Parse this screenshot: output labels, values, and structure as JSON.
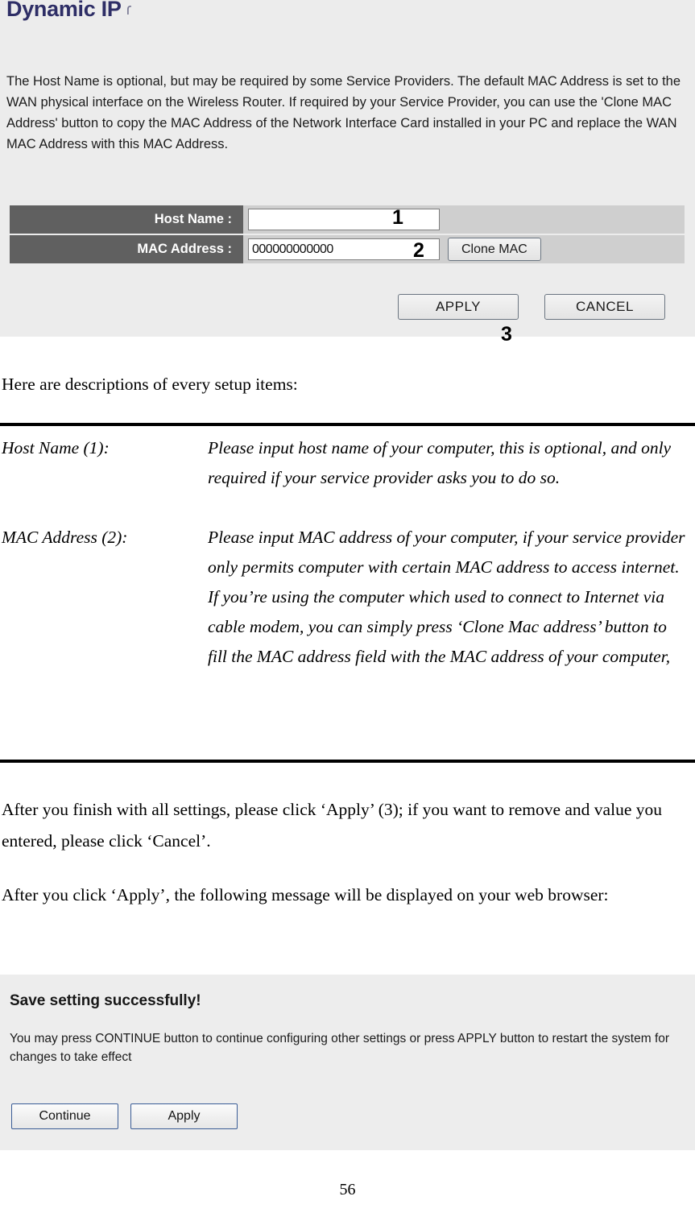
{
  "router_screenshot": {
    "title": "Dynamic IP",
    "title_glyph": "icon-glyph",
    "description": "The Host Name is optional, but may be required by some Service Providers. The default MAC Address is set to the WAN physical interface on the Wireless Router. If required by your Service Provider, you can use the 'Clone MAC Address' button to copy the MAC Address of the Network Interface Card installed in your PC and replace the WAN MAC Address with this MAC Address.",
    "fields": [
      {
        "label": "Host Name :",
        "value": "",
        "callout": "1"
      },
      {
        "label": "MAC Address :",
        "value": "000000000000",
        "callout": "2"
      }
    ],
    "clone_button": "Clone MAC",
    "apply_button": "APPLY",
    "cancel_button": "CANCEL",
    "apply_callout": "3",
    "colors": {
      "panel_background": "#ececec",
      "label_cell": "#606060",
      "field_cell": "#cfcfcf",
      "title_text": "#2e2e66"
    }
  },
  "document": {
    "intro": "Here are descriptions of every setup items:",
    "descriptions": [
      {
        "term": "Host Name (1):",
        "text": "Please input host name of your computer, this is optional, and only required if your service provider asks you to do so."
      },
      {
        "term": "MAC Address (2):",
        "text": "Please input MAC address of your computer, if your service provider only permits computer with certain MAC address to access internet. If you’re using the computer which used to connect to Internet via cable modem, you can simply press ‘Clone Mac address’ button to fill the MAC address field with the MAC address of your computer,"
      }
    ],
    "paragraphs": [
      "After you finish with all settings, please click ‘Apply’ (3); if you want to remove and value you entered, please click ‘Cancel’.",
      "After you click ‘Apply’, the following message will be displayed on your web browser:"
    ],
    "page_number": "56"
  },
  "save_dialog": {
    "title": "Save setting successfully!",
    "message": "You may press CONTINUE button to continue configuring other settings or press APPLY button to restart the system for changes to take effect",
    "continue_button": "Continue",
    "apply_button": "Apply",
    "colors": {
      "background": "#ededed",
      "button_border": "#3a5c96"
    }
  }
}
